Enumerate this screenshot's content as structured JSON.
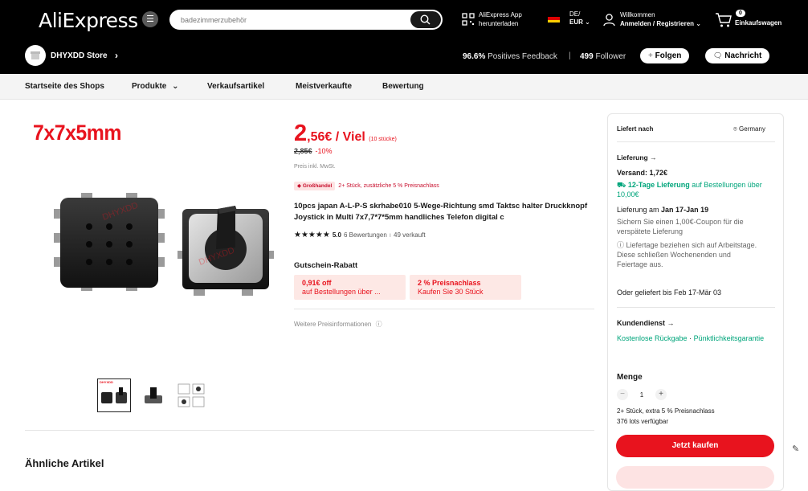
{
  "header": {
    "logo": "AliExpress",
    "search": {
      "placeholder": "badezimmerzubehör"
    },
    "app": {
      "line1": "AliExpress App",
      "line2": "herunterladen"
    },
    "lang": {
      "line1": "DE/",
      "line2": "EUR"
    },
    "account": {
      "line1": "Willkommen",
      "line2": "Anmelden / Registrieren"
    },
    "cart": {
      "count": "0",
      "label": "Einkaufswagen"
    }
  },
  "store": {
    "name": "DHYXDD Store",
    "feedback_value": "96.6%",
    "feedback_label": "Positives Feedback",
    "followers_value": "499",
    "followers_label": "Follower",
    "follow_label": "Folgen",
    "message_label": "Nachricht"
  },
  "nav": {
    "items": [
      "Startseite des Shops",
      "Produkte",
      "Verkaufsartikel",
      "Meistverkaufte",
      "Bewertung"
    ]
  },
  "gallery": {
    "hero_label": "7x7x5mm",
    "watermark": "DHYXDD",
    "thumb_label": "DHYXDD"
  },
  "product": {
    "price_int": "2",
    "price_dec": ",56€ / Viel",
    "price_unit": "(10 stücke)",
    "old_price": "2,85€",
    "discount": "-10%",
    "tax": "Preis inkl. MwSt.",
    "wholesale_badge": "Großhandel",
    "wholesale_note": "2+ Stück, zusätzliche 5 % Preisnachlass",
    "title": "10pcs japan A-L-P-S skrhabe010 5-Wege-Richtung smd Taktsc halter Druckknopf Joystick in Multi 7x7,7*7*5mm handliches Telefon digital c",
    "stars": "★★★★★",
    "rating": "5.0",
    "reviews": "6 Bewertungen",
    "sold": "49 verkauft",
    "coupon_title": "Gutschein-Rabatt",
    "coupons": [
      {
        "title": "0,91€ off",
        "sub": "auf Bestellungen über ..."
      },
      {
        "title": "2 % Preisnachlass",
        "sub": "Kaufen Sie 30 Stück"
      }
    ],
    "more_price": "Weitere Preisinformationen"
  },
  "sidebar": {
    "ship_to_label": "Liefert nach",
    "ship_to_country": "Germany",
    "delivery_label": "Lieferung",
    "shipping": "Versand: 1,72€",
    "fast_delivery": "12-Tage Lieferung",
    "fast_delivery_tail": " auf Bestellungen über 10,00€",
    "delivery_date_prefix": "Lieferung am ",
    "delivery_date": "Jan 17-Jan 19",
    "coupon_note": "Sichern Sie einen 1,00€-Coupon für die verspätete Lieferung",
    "workdays_note": "Liefertage beziehen sich auf Arbeitstage. Diese schließen Wochenenden und Feiertage aus.",
    "alt_delivery": "Oder geliefert bis Feb 17-Mär 03",
    "service_label": "Kundendienst",
    "service_returns": "Kostenlose Rückgabe",
    "service_punctual": "Pünktlichkeitsgarantie",
    "quantity_label": "Menge",
    "quantity_value": "1",
    "bulk_note": "2+ Stück, extra 5 % Preisnachlass",
    "stock_note": "376 lots verfügbar",
    "buy_now": "Jetzt kaufen"
  },
  "similar": {
    "title": "Ähnliche Artikel"
  },
  "colors": {
    "accent": "#e8131e",
    "green": "#00a57b",
    "topbar": "#000000"
  }
}
